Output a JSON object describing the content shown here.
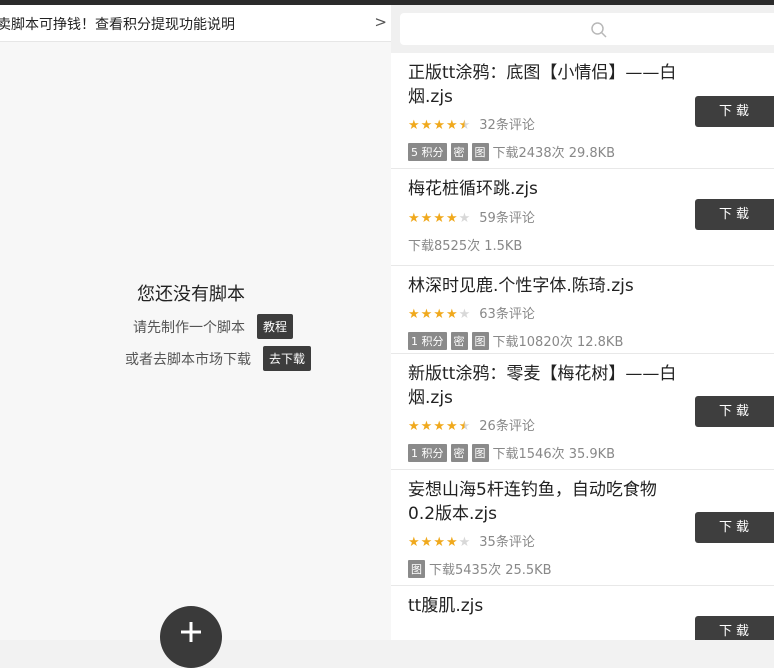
{
  "banner": {
    "text": "卖脚本可挣钱！查看积分提现功能说明",
    "arrow": ">"
  },
  "empty_state": {
    "title": "您还没有脚本",
    "line1": "请先制作一个脚本",
    "line1_tag": "教程",
    "line2": "或者去脚本市场下载",
    "line2_tag": "去下载"
  },
  "fab": {
    "icon": "plus-icon"
  },
  "search": {
    "icon": "search-icon"
  },
  "scripts": [
    {
      "title": "正版tt涂鸦：底图【小情侣】——白烟.zjs",
      "rating": 4.5,
      "comments": "32条评论",
      "badges": [
        "5 积分",
        "密",
        "图"
      ],
      "downloads": "下载2438次 29.8KB",
      "button": "下载"
    },
    {
      "title": "梅花桩循环跳.zjs",
      "rating": 4,
      "comments": "59条评论",
      "badges": [],
      "downloads": "下载8525次 1.5KB",
      "button": "下载"
    },
    {
      "title": "林深时见鹿.个性字体.陈琦.zjs",
      "rating": 4,
      "comments": "63条评论",
      "badges": [
        "1 积分",
        "密",
        "图"
      ],
      "downloads": "下载10820次 12.8KB",
      "button": "下载"
    },
    {
      "title": "新版tt涂鸦：零麦【梅花树】——白烟.zjs",
      "rating": 4.5,
      "comments": "26条评论",
      "badges": [
        "1 积分",
        "密",
        "图"
      ],
      "downloads": "下载1546次 35.9KB",
      "button": "下载"
    },
    {
      "title": "妄想山海5杆连钓鱼，自动吃食物0.2版本.zjs",
      "rating": 4,
      "comments": "35条评论",
      "badges": [
        "图"
      ],
      "downloads": "下载5435次 25.5KB",
      "button": "下载"
    },
    {
      "title": "tt腹肌.zjs",
      "rating": null,
      "comments": "",
      "badges": [],
      "downloads": "",
      "button": "下载"
    }
  ],
  "colors": {
    "star": "#f0a91d",
    "button": "#3e3e3e",
    "badge": "#8a8a8a"
  }
}
